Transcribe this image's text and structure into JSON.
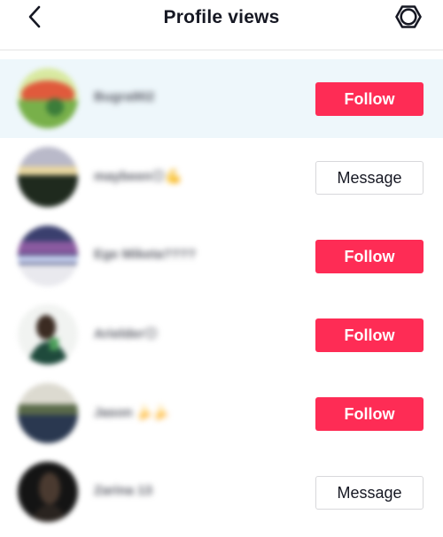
{
  "header": {
    "title": "Profile views",
    "back_icon": "chevron-left-icon",
    "settings_icon": "gear-icon"
  },
  "colors": {
    "follow_button": "#fe2c55",
    "highlight_row": "#eef7fb",
    "divider": "#e3e3e4"
  },
  "viewers": [
    {
      "username": "Bugra902",
      "action": "Follow",
      "action_type": "follow",
      "highlighted": true
    },
    {
      "username": "maybeen😊💪",
      "action": "Message",
      "action_type": "message",
      "highlighted": false
    },
    {
      "username": "Ege Miketa????",
      "action": "Follow",
      "action_type": "follow",
      "highlighted": false
    },
    {
      "username": "Arielder😊",
      "action": "Follow",
      "action_type": "follow",
      "highlighted": false
    },
    {
      "username": "Jason 🍌🍌",
      "action": "Follow",
      "action_type": "follow",
      "highlighted": false
    },
    {
      "username": "Zarina 13",
      "action": "Message",
      "action_type": "message",
      "highlighted": false
    }
  ]
}
